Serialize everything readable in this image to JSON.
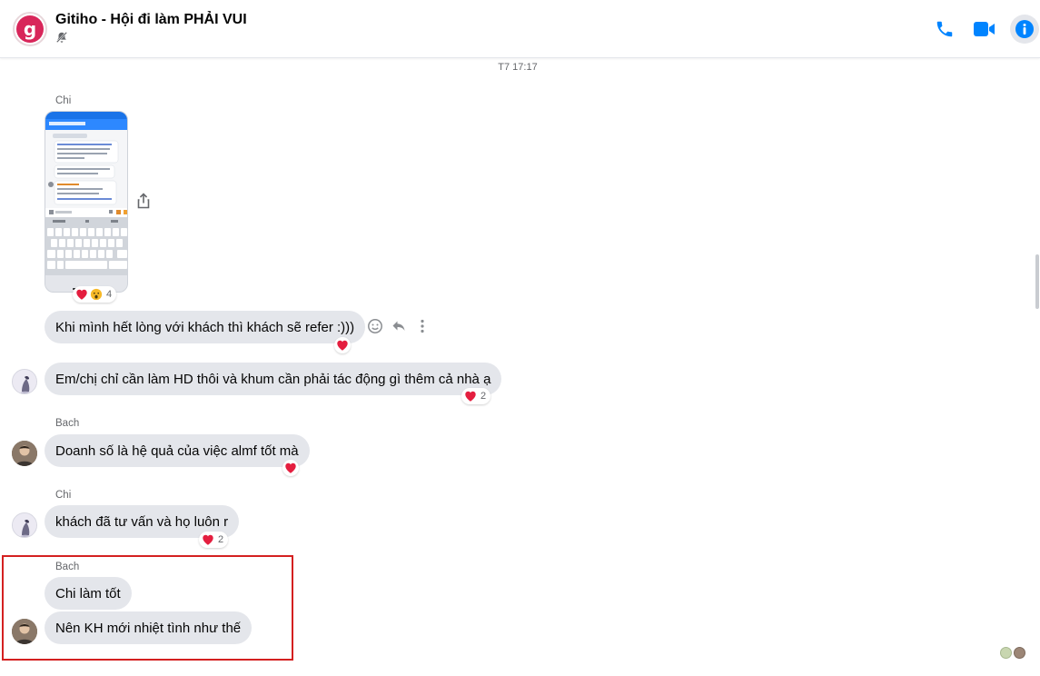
{
  "header": {
    "title": "Gitiho - Hội đi làm PHẢI VUI",
    "avatar_letter": "g",
    "muted": true,
    "accent_color": "#0084ff"
  },
  "conversation": {
    "timestamp": "T7 17:17",
    "senders": {
      "chi": "Chi",
      "bach": "Bach"
    },
    "image_message": {
      "reaction_count": "4",
      "reaction_icons": [
        "heart-icon",
        "wow-face-icon"
      ]
    },
    "messages": [
      {
        "text": "Khi mình hết lòng với khách thì khách sẽ refer :)))",
        "reaction_icon": "heart-icon"
      },
      {
        "text": "Em/chị chỉ cần làm HD thôi và khum cần phải tác động gì thêm cả nhà ạ",
        "reaction_count": "2"
      },
      {
        "text": "Doanh số là hệ quả của việc almf tốt mà",
        "reaction_icon": "heart-icon"
      },
      {
        "text": "khách đã tư vấn và họ luôn r",
        "reaction_count": "2"
      },
      {
        "text": "Chi làm tốt"
      },
      {
        "text": "Nên KH mới nhiệt tình như thế"
      }
    ]
  },
  "icons": {
    "call": "phone-icon",
    "video": "video-camera-icon",
    "info": "info-icon",
    "share": "share-icon",
    "react": "smiley-icon",
    "reply": "reply-icon",
    "more": "more-vertical-icon"
  },
  "colors": {
    "bubble": "#e4e6eb",
    "heart": "#e41e3f",
    "highlight": "#d42020",
    "brand": "#d8265a"
  }
}
